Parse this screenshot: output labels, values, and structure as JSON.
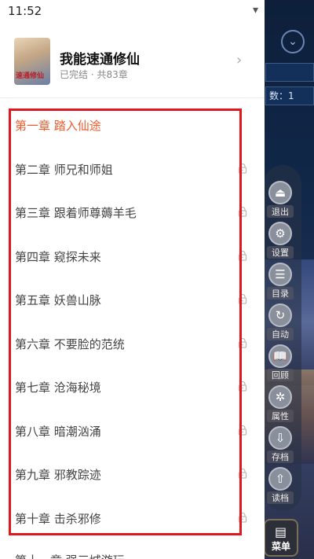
{
  "status": {
    "time": "11:52"
  },
  "book": {
    "title": "我能速通修仙",
    "meta": "已完结 · 共83章",
    "cover_text": "速通修仙"
  },
  "chapters": [
    {
      "title": "第一章 踏入仙途",
      "active": true,
      "locked": false
    },
    {
      "title": "第二章 师兄和师姐",
      "active": false,
      "locked": true
    },
    {
      "title": "第三章 跟着师尊薅羊毛",
      "active": false,
      "locked": true
    },
    {
      "title": "第四章 窥探未来",
      "active": false,
      "locked": true
    },
    {
      "title": "第五章 妖兽山脉",
      "active": false,
      "locked": true
    },
    {
      "title": "第六章 不要脸的范统",
      "active": false,
      "locked": true
    },
    {
      "title": "第七章 沧海秘境",
      "active": false,
      "locked": true
    },
    {
      "title": "第八章 暗潮汹涌",
      "active": false,
      "locked": true
    },
    {
      "title": "第九章 邪教踪迹",
      "active": false,
      "locked": true
    },
    {
      "title": "第十章 击杀邪修",
      "active": false,
      "locked": true
    }
  ],
  "partial_chapter": "第十一章 强三城游玩",
  "game": {
    "field_value": "数：1",
    "menu": [
      {
        "icon": "exit-icon",
        "label": "退出",
        "glyph": "⏏"
      },
      {
        "icon": "settings-icon",
        "label": "设置",
        "glyph": "⚙"
      },
      {
        "icon": "catalog-icon",
        "label": "目录",
        "glyph": "☰"
      },
      {
        "icon": "auto-icon",
        "label": "自动",
        "glyph": "↻"
      },
      {
        "icon": "review-icon",
        "label": "回顾",
        "glyph": "📖"
      },
      {
        "icon": "attribute-icon",
        "label": "属性",
        "glyph": "✲"
      },
      {
        "icon": "save-icon",
        "label": "存档",
        "glyph": "⇩"
      },
      {
        "icon": "load-icon",
        "label": "读档",
        "glyph": "⇧"
      }
    ],
    "menu_button": "菜单"
  },
  "colors": {
    "active_chapter": "#ef5a2d",
    "highlight_border": "#e0171b"
  }
}
